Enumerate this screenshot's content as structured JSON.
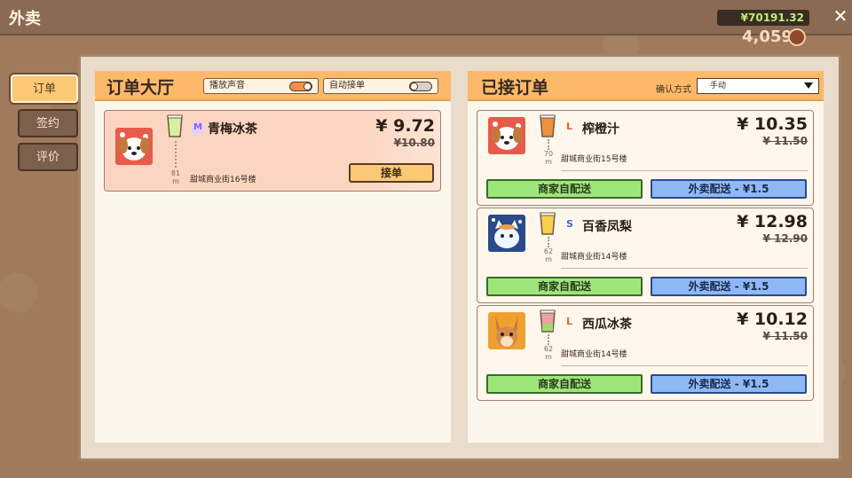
{
  "window": {
    "title": "外卖",
    "close_label": "✕"
  },
  "wallet": {
    "money": "¥70191.32",
    "coins": "4,059"
  },
  "sidebar": {
    "tabs": [
      {
        "label": "订单"
      },
      {
        "label": "签约"
      },
      {
        "label": "评价"
      }
    ]
  },
  "hall": {
    "title": "订单大厅",
    "toggles": [
      {
        "label": "播放声音",
        "state": "on"
      },
      {
        "label": "自动接单",
        "state": "off"
      }
    ],
    "orders": [
      {
        "avatar": "dog-icon",
        "size": "M",
        "name": "青梅冰茶",
        "price": "¥ 9.72",
        "old_price": "¥10.80",
        "distance": "81",
        "distance_unit": "m",
        "address": "甜城商业街16号楼",
        "accept_label": "接单"
      }
    ]
  },
  "accepted": {
    "title": "已接订单",
    "confirm_label": "确认方式",
    "confirm_value": "手动",
    "orders": [
      {
        "avatar": "dog-icon",
        "size": "L",
        "name": "榨橙汁",
        "price": "¥ 10.35",
        "old_price": "¥ 11.50",
        "distance": "70",
        "distance_unit": "m",
        "address": "甜城商业街15号楼",
        "self_delivery": "商家自配送",
        "courier_delivery": "外卖配送 - ¥1.5"
      },
      {
        "avatar": "cat-icon",
        "size": "S",
        "name": "百香凤梨",
        "price": "¥ 12.98",
        "old_price": "¥ 12.90",
        "distance": "62",
        "distance_unit": "m",
        "address": "甜城商业街14号楼",
        "self_delivery": "商家自配送",
        "courier_delivery": "外卖配送 - ¥1.5"
      },
      {
        "avatar": "kangaroo-icon",
        "size": "L",
        "name": "西瓜冰茶",
        "price": "¥ 10.12",
        "old_price": "¥ 11.50",
        "distance": "62",
        "distance_unit": "m",
        "address": "甜城商业街14号楼",
        "self_delivery": "商家自配送",
        "courier_delivery": "外卖配送 - ¥1.5"
      }
    ]
  },
  "colors": {
    "size_M": "#8a60d8",
    "size_S": "#3a6ad8",
    "size_L": "#e8623a",
    "accent": "#fbb969"
  }
}
